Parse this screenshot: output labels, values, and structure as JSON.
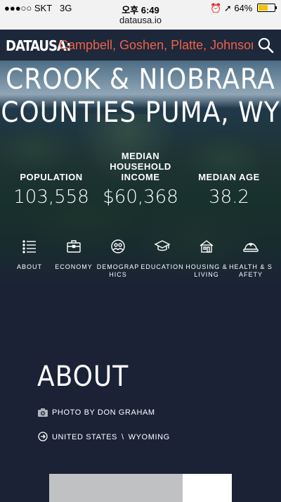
{
  "status_bar": {
    "carrier": "●●●○○ SKT",
    "network": "3G",
    "time": "오후 6:49",
    "battery": "64%",
    "battery_level": 0.64
  },
  "browser": {
    "url": "datausa.io"
  },
  "navbar": {
    "logo": "DATAUSA:",
    "places": "Campbell, Goshen, Platte, Johnson, ",
    "accent_color": "#ef6145"
  },
  "hero": {
    "title_line1": "CROOK & NIOBRARA",
    "title_line2": "COUNTIES PUMA, WY",
    "stats": [
      {
        "label": "POPULATION",
        "value": "103,558"
      },
      {
        "label": "MEDIAN HOUSEHOLD INCOME",
        "value": "$60,368"
      },
      {
        "label": "MEDIAN AGE",
        "value": "38.2"
      }
    ],
    "topics": [
      {
        "label": "ABOUT",
        "icon": "list-icon"
      },
      {
        "label": "ECONOMY",
        "icon": "briefcase-icon"
      },
      {
        "label": "DEMOGRAPHICS",
        "icon": "people-icon"
      },
      {
        "label": "EDUCATION",
        "icon": "graduation-cap-icon"
      },
      {
        "label": "HOUSING & LIVING",
        "icon": "house-icon"
      },
      {
        "label": "HEALTH & SAFETY",
        "icon": "hardhat-icon"
      }
    ]
  },
  "about": {
    "heading": "ABOUT",
    "photo_credit": "PHOTO BY DON GRAHAM",
    "breadcrumb": [
      "UNITED STATES",
      "WYOMING"
    ]
  }
}
